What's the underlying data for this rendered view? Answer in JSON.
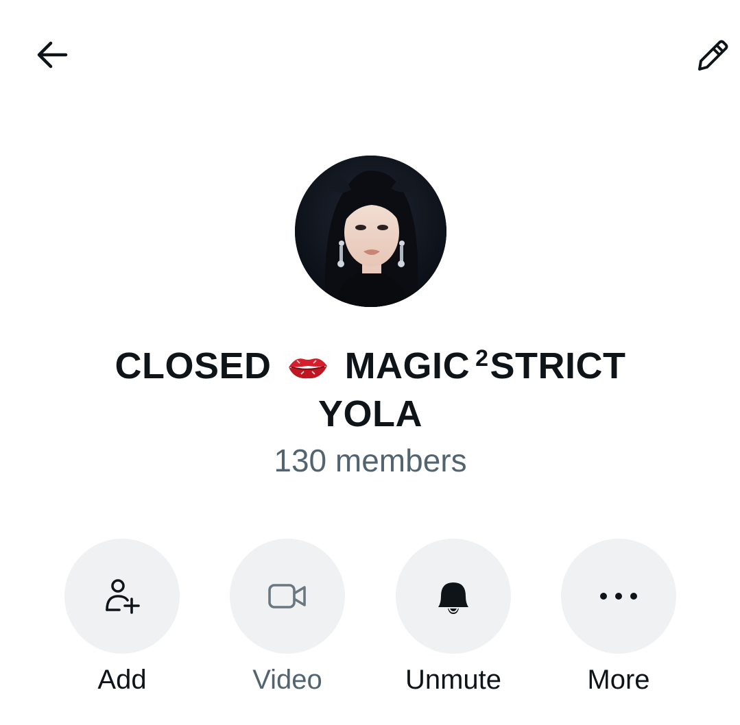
{
  "header": {
    "back_icon": "arrow-left-icon",
    "edit_icon": "pencil-icon"
  },
  "group": {
    "title_part1": "CLOSED",
    "title_emoji": "lips-emoji",
    "title_part2": "MAGIC",
    "title_superscript": "2",
    "title_part3": "STRICT",
    "title_line2": "YOLA",
    "member_count": "130 members"
  },
  "actions": [
    {
      "label": "Add",
      "icon": "person-plus-icon",
      "enabled": true
    },
    {
      "label": "Video",
      "icon": "video-camera-icon",
      "enabled": false
    },
    {
      "label": "Unmute",
      "icon": "bell-icon",
      "enabled": true
    },
    {
      "label": "More",
      "icon": "more-dots-icon",
      "enabled": true
    }
  ],
  "colors": {
    "text_primary": "#0f1419",
    "text_secondary": "#536471",
    "button_bg": "#eff1f3",
    "disabled_icon": "#6b7780",
    "lips_red": "#d61f2c"
  }
}
